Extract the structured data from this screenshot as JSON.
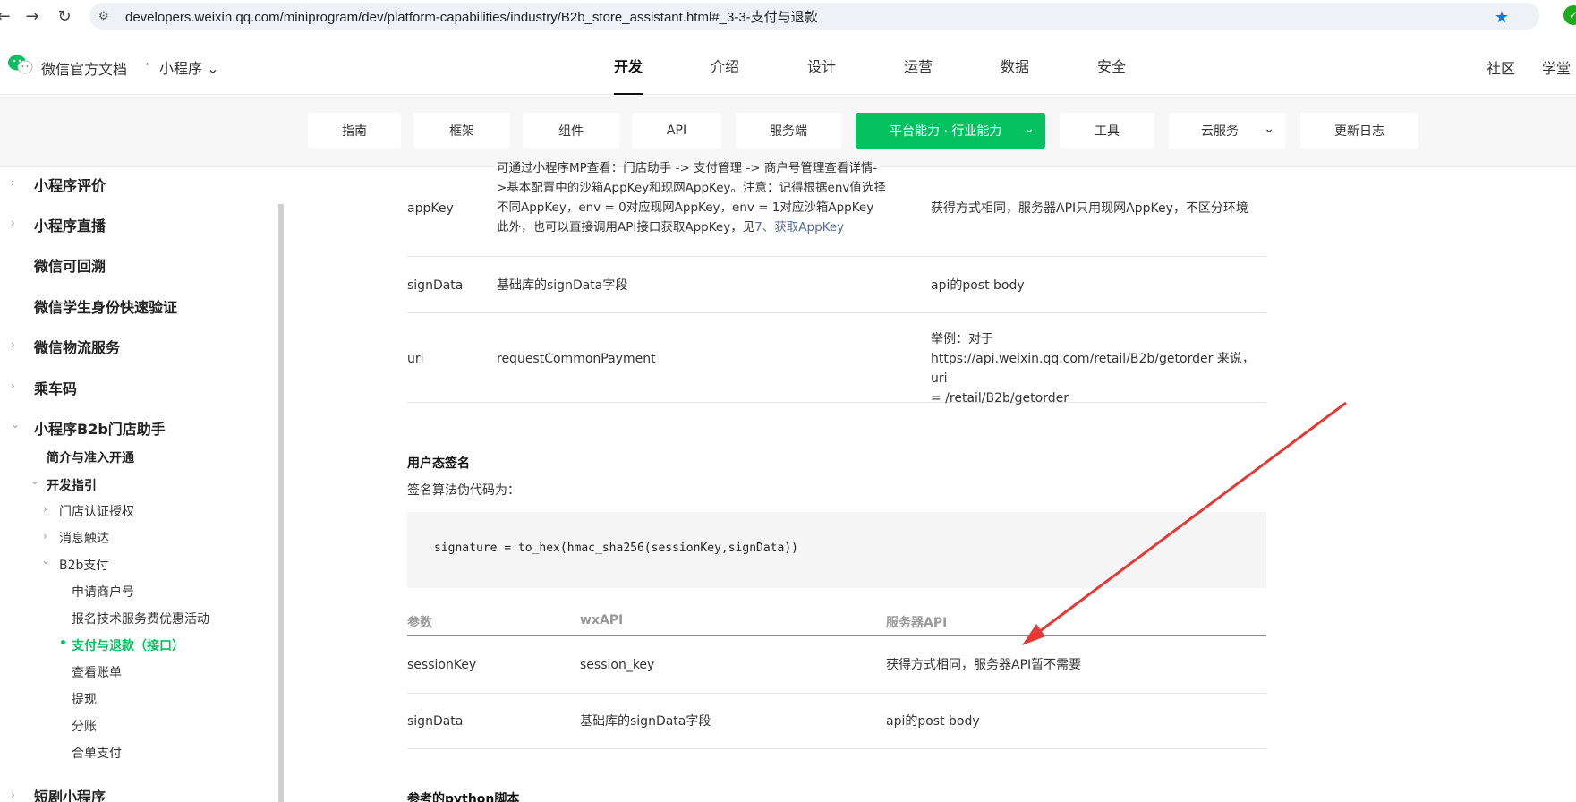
{
  "browser": {
    "url": "developers.weixin.qq.com/miniprogram/dev/platform-capabilities/industry/B2b_store_assistant.html#_3-3-支付与退款"
  },
  "header": {
    "brand": "微信官方文档",
    "dot": "·",
    "product": "小程序",
    "nav": [
      "开发",
      "介绍",
      "设计",
      "运营",
      "数据",
      "安全"
    ],
    "right": [
      "社区",
      "学堂"
    ]
  },
  "subnav": {
    "items": [
      "指南",
      "框架",
      "组件",
      "API",
      "服务端",
      "平台能力 · 行业能力",
      "工具",
      "云服务",
      "更新日志"
    ]
  },
  "sidebar": {
    "top_items": [
      "小程序评价",
      "小程序直播",
      "微信可回溯",
      "微信学生身份快速验证",
      "微信物流服务",
      "乘车码",
      "小程序B2b门店助手"
    ],
    "intro": "简介与准入开通",
    "dev_guide": "开发指引",
    "guide_items": [
      "门店认证授权",
      "消息触达",
      "B2b支付"
    ],
    "pay_items": [
      "申请商户号",
      "报名技术服务费优惠活动",
      "支付与退款（接口）",
      "查看账单",
      "提现",
      "分账",
      "合单支付"
    ],
    "bottom_item": "短剧小程序"
  },
  "table1": {
    "rows": [
      {
        "param": "appKey",
        "wx_lines": [
          "可通过小程序MP查看：门店助手 -> 支付管理 -> 商户号管理查看详情-",
          ">基本配置中的沙箱AppKey和现网AppKey。注意：记得根据env值选择",
          "不同AppKey，env = 0对应现网AppKey，env = 1对应沙箱AppKey",
          "此外，也可以直接调用API接口获取AppKey，见"
        ],
        "wx_link": "7、获取AppKey",
        "server": "获得方式相同，服务器API只用现网AppKey，不区分环境"
      },
      {
        "param": "signData",
        "wx": "基础库的signData字段",
        "server": "api的post body"
      },
      {
        "param": "uri",
        "wx": "requestCommonPayment",
        "server_lines": [
          "举例：对于",
          "https://api.weixin.qq.com/retail/B2b/getorder 来说，uri",
          "= /retail/B2b/getorder"
        ]
      }
    ]
  },
  "user_sign": {
    "title": "用户态签名",
    "desc": "签名算法伪代码为：",
    "code": "signature = to_hex(hmac_sha256(sessionKey,signData))"
  },
  "table2": {
    "headers": [
      "参数",
      "wxAPI",
      "服务器API"
    ],
    "rows": [
      {
        "param": "sessionKey",
        "wx": "session_key",
        "server": "获得方式相同，服务器API暂不需要"
      },
      {
        "param": "signData",
        "wx": "基础库的signData字段",
        "server": "api的post body"
      }
    ]
  },
  "next_section": {
    "title": "参考的python脚本"
  },
  "colors": {
    "accent": "#07c160",
    "annotation": "#e53935",
    "link": "#576b95"
  }
}
